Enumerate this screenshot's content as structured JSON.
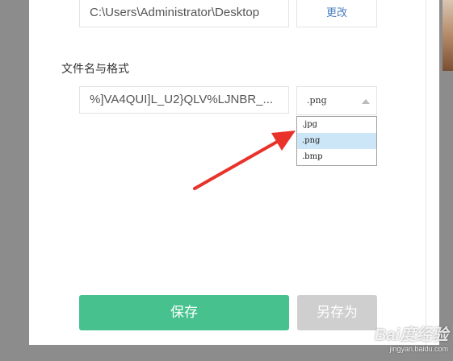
{
  "save_dialog": {
    "path_value": "C:\\Users\\Administrator\\Desktop",
    "change_label": "更改",
    "section_label": "文件名与格式",
    "filename_value": "%]VA4QUI]L_U2}QLV%LJNBR_...",
    "format_selected": ".png",
    "format_options": [
      ".jpg",
      ".png",
      ".bmp"
    ],
    "save_label": "保存",
    "save_as_label": "另存为"
  },
  "watermark": {
    "brand": "Bai度经验",
    "url": "jingyan.baidu.com"
  },
  "colors": {
    "primary_button": "#47c28e",
    "disabled_button": "#cfcfcf",
    "selected_option": "#cde6f7",
    "annotation_arrow": "#e8322a",
    "link": "#4a7fc1"
  }
}
